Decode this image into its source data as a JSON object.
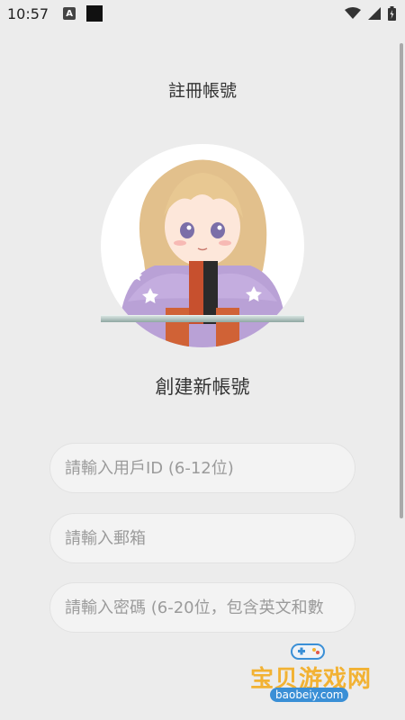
{
  "status_bar": {
    "time": "10:57",
    "notification_letter": "A"
  },
  "header": {
    "title": "註冊帳號"
  },
  "main": {
    "create_title": "創建新帳號",
    "fields": {
      "user_id": {
        "value": "",
        "placeholder": "請輸入用戶ID (6-12位)"
      },
      "email": {
        "value": "",
        "placeholder": "請輸入郵箱"
      },
      "password": {
        "value": "",
        "placeholder": "請輸入密碼 (6-20位，包含英文和數"
      }
    }
  },
  "watermark": {
    "text": "宝贝游戏网",
    "url": "baobeiy.com"
  },
  "colors": {
    "background": "#ececec",
    "field_background": "#f3f3f3",
    "watermark_gold": "#f2b233",
    "watermark_blue": "#3a8fd6"
  },
  "icons": [
    "wifi-icon",
    "cellular-signal-icon",
    "battery-icon",
    "gamepad-icon"
  ]
}
